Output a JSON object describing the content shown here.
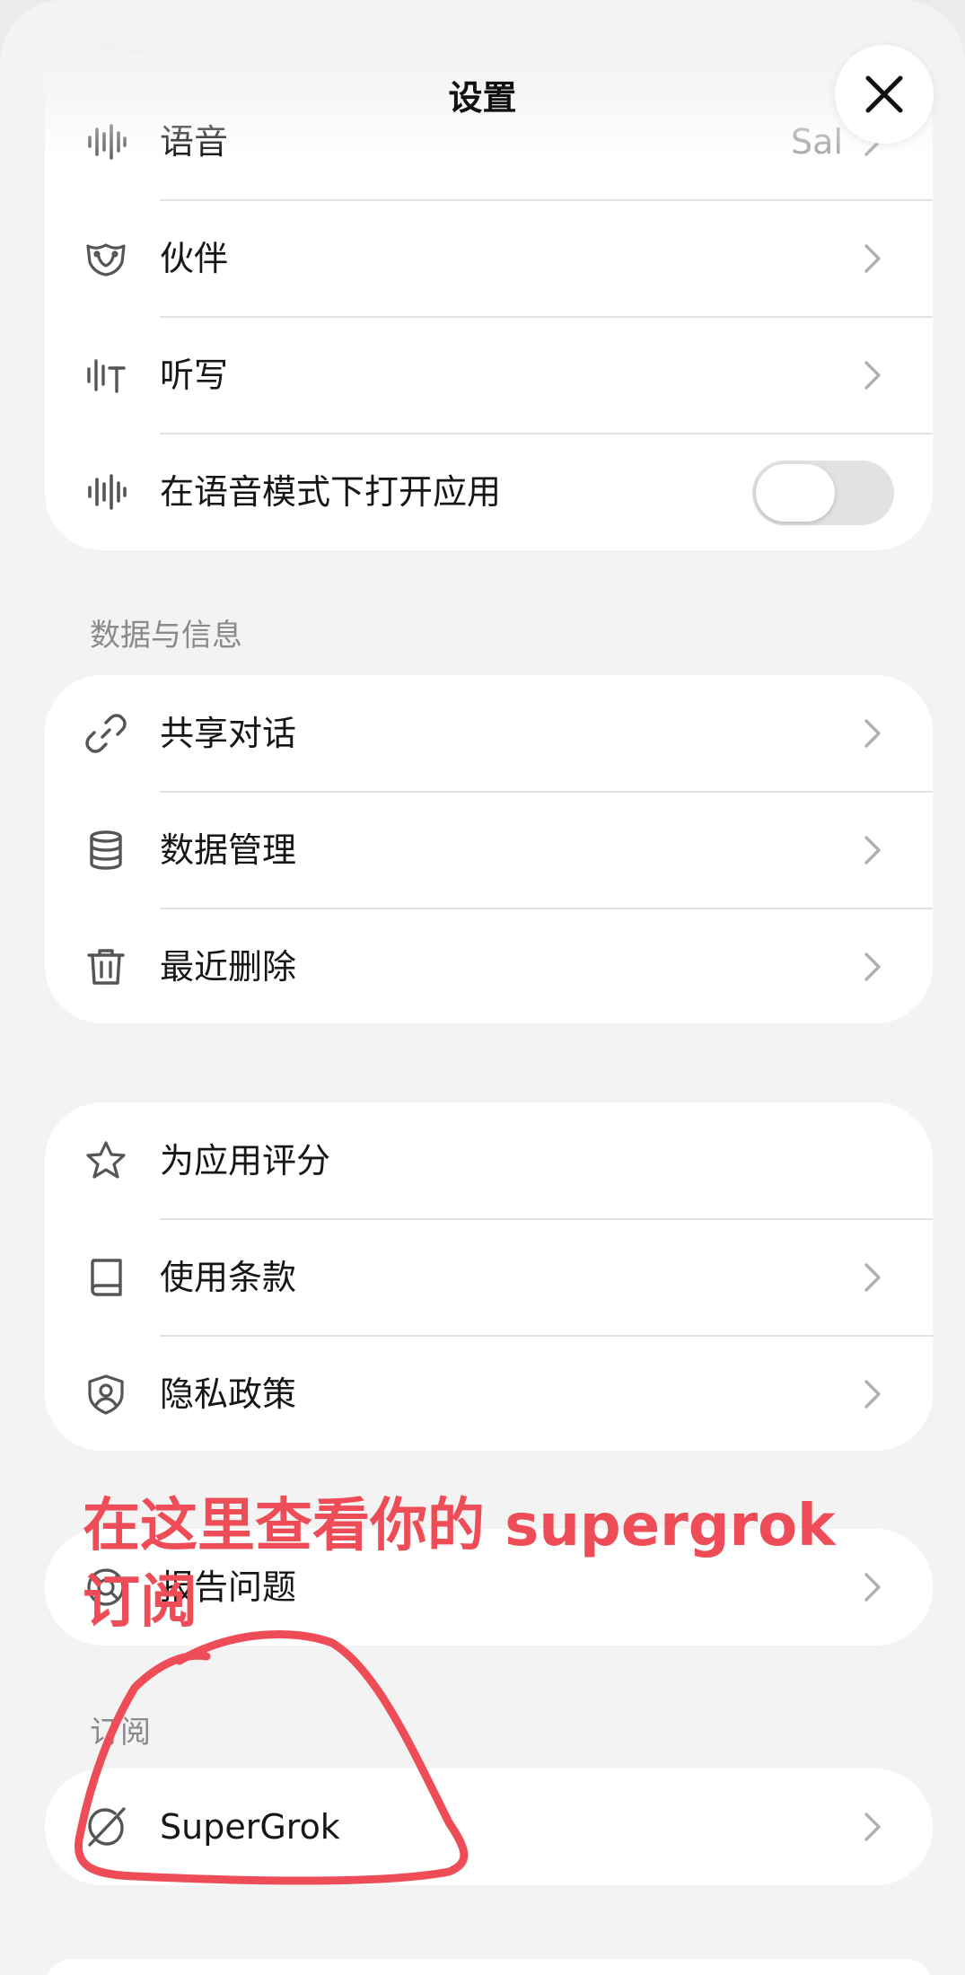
{
  "header": {
    "title": "设置",
    "ghost_title": "语音"
  },
  "voice_card": {
    "rows": [
      {
        "label": "语音",
        "value": "Sal"
      },
      {
        "label": "伙伴"
      },
      {
        "label": "听写"
      },
      {
        "label": "在语音模式下打开应用",
        "toggle_on": false
      }
    ]
  },
  "data_section": {
    "title": "数据与信息",
    "rows": [
      {
        "label": "共享对话"
      },
      {
        "label": "数据管理"
      },
      {
        "label": "最近删除"
      }
    ]
  },
  "about_card": {
    "rows": [
      {
        "label": "为应用评分"
      },
      {
        "label": "使用条款"
      },
      {
        "label": "隐私政策"
      }
    ]
  },
  "support_card": {
    "rows": [
      {
        "label": "报告问题"
      }
    ]
  },
  "subscription_section": {
    "title": "订阅",
    "rows": [
      {
        "label": "SuperGrok"
      }
    ]
  },
  "annotation": {
    "line1": "在这里查看你的 supergrok",
    "line2": "订阅"
  },
  "colors": {
    "annotation": "#ee4c56",
    "background": "#f3f3f4",
    "card": "#ffffff"
  }
}
